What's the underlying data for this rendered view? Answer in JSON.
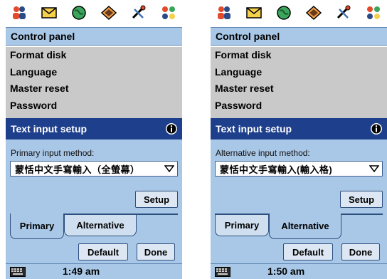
{
  "screens": [
    {
      "topbar_icons": [
        "contacts-icon",
        "messages-icon",
        "web-icon",
        "applications-icon",
        "tools-icon",
        "extras-icon"
      ],
      "header_title": "Control panel",
      "list_items": [
        "Format disk",
        "Language",
        "Master reset",
        "Password"
      ],
      "dialog_title": "Text input setup",
      "field_label": "Primary input method:",
      "selected_method": "蒙恬中文手寫輸入（全螢幕）",
      "setup_label": "Setup",
      "tabs": [
        {
          "label": "Primary",
          "active": true
        },
        {
          "label": "Alternative",
          "active": false
        }
      ],
      "default_label": "Default",
      "done_label": "Done",
      "time": "1:49 am"
    },
    {
      "topbar_icons": [
        "contacts-icon",
        "messages-icon",
        "web-icon",
        "applications-icon",
        "tools-icon",
        "extras-icon"
      ],
      "header_title": "Control panel",
      "list_items": [
        "Format disk",
        "Language",
        "Master reset",
        "Password"
      ],
      "dialog_title": "Text input setup",
      "field_label": "Alternative input method:",
      "selected_method": "蒙恬中文手寫輸入(輸入格)",
      "setup_label": "Setup",
      "tabs": [
        {
          "label": "Primary",
          "active": false
        },
        {
          "label": "Alternative",
          "active": true
        }
      ],
      "default_label": "Default",
      "done_label": "Done",
      "time": "1:50 am"
    }
  ],
  "colors": {
    "header_bg": "#a9c7e6",
    "dialog_title_bg": "#1e3f8c",
    "list_bg": "#c9c9c9"
  }
}
